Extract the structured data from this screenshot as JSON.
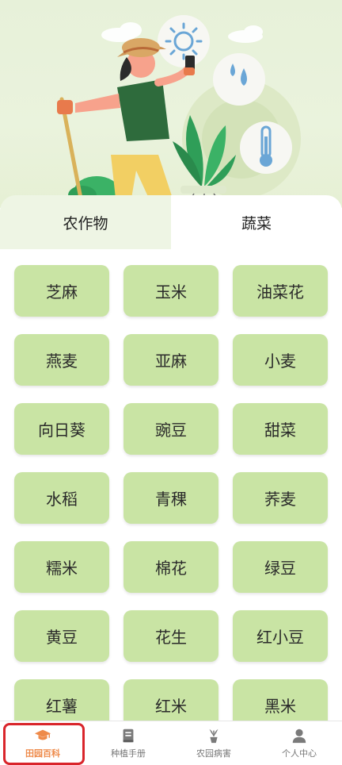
{
  "tabs": {
    "crops": "农作物",
    "vegetables": "蔬菜"
  },
  "crops": [
    "芝麻",
    "玉米",
    "油菜花",
    "燕麦",
    "亚麻",
    "小麦",
    "向日葵",
    "豌豆",
    "甜菜",
    "水稻",
    "青稞",
    "荞麦",
    "糯米",
    "棉花",
    "绿豆",
    "黄豆",
    "花生",
    "红小豆",
    "红薯",
    "红米",
    "黑米"
  ],
  "nav": {
    "items": [
      {
        "label": "田园百科",
        "icon": "graduation-cap-icon",
        "active": true
      },
      {
        "label": "种植手册",
        "icon": "book-icon",
        "active": false
      },
      {
        "label": "农园病害",
        "icon": "potted-plant-icon",
        "active": false
      },
      {
        "label": "个人中心",
        "icon": "user-icon",
        "active": false
      }
    ]
  },
  "colors": {
    "accent": "#ee8a4a",
    "tile": "#c9e4a4",
    "highlight_border": "#d9252b"
  }
}
